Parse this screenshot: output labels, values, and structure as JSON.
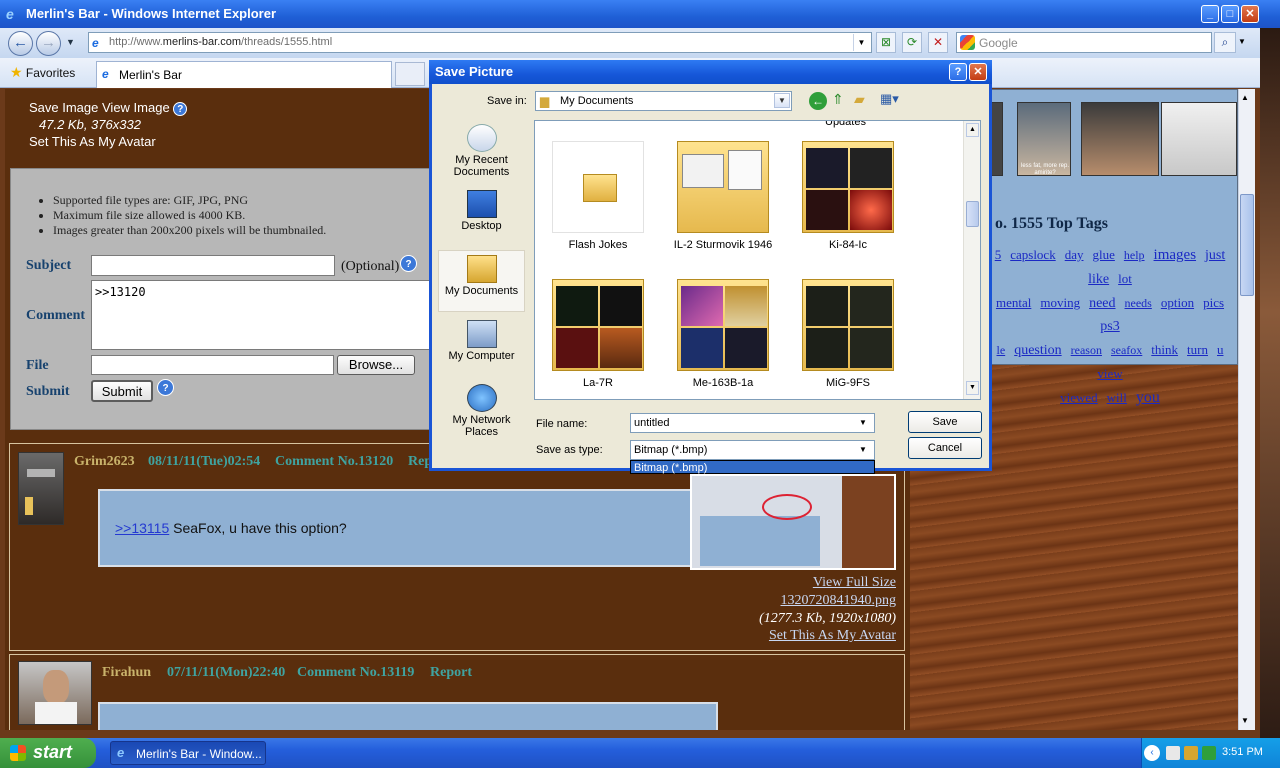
{
  "window": {
    "title": "Merlin's Bar - Windows Internet Explorer",
    "url_prefix": "http://www.",
    "url_domain": "merlins-bar.com",
    "url_path": "/threads/1555.html",
    "search_placeholder": "Google",
    "favorites_label": "Favorites",
    "tab_label": "Merlin's Bar"
  },
  "image_links": {
    "save_image": "Save Image",
    "view_image": "View Image",
    "size_info": "47.2 Kb, 376x332",
    "set_avatar": "Set This As My Avatar"
  },
  "form": {
    "rules": [
      "Supported file types are: GIF, JPG, PNG",
      "Maximum file size allowed is 4000 KB.",
      "Images greater than 200x200 pixels will be thumbnailed."
    ],
    "subject_label": "Subject",
    "optional_label": "(Optional)",
    "comment_label": "Comment",
    "comment_value": ">>13120",
    "file_label": "File",
    "browse_button": "Browse...",
    "submit_label": "Submit",
    "submit_button": "Submit"
  },
  "posts": [
    {
      "poster": "Grim2623",
      "date": "08/11/11(Tue)02:54",
      "comment_no": "Comment No.13120",
      "report": "Report",
      "reply_link": ">>13115",
      "text": " SeaFox, u have this option?",
      "view_full": "View Full Size",
      "filename": "1320720841940.png",
      "fileinfo": "(1277.3 Kb, 1920x1080)",
      "set_avatar": "Set This As My Avatar"
    },
    {
      "poster": "Firahun",
      "date": "07/11/11(Mon)22:40",
      "comment_no": "Comment No.13119",
      "report": "Report"
    }
  ],
  "tags": {
    "title": "o. 1555 Top Tags",
    "words": [
      "5",
      "capslock",
      "day",
      "glue",
      "help",
      "images",
      "just",
      "like",
      "lot",
      "mental",
      "moving",
      "need",
      "needs",
      "option",
      "pics",
      "ps3",
      "le",
      "question",
      "reason",
      "seafox",
      "think",
      "turn",
      "u",
      "view",
      "viewed",
      "will",
      "you"
    ],
    "thumb_caption": "less fat, more rep. amirite?"
  },
  "dialog": {
    "title": "Save Picture",
    "save_in_label": "Save in:",
    "save_in_value": "My Documents",
    "places": [
      "My Recent Documents",
      "Desktop",
      "My Documents",
      "My Computer",
      "My Network Places"
    ],
    "partial_label": "Updates",
    "files": [
      "Flash Jokes",
      "IL-2 Sturmovik 1946",
      "Ki-84-Ic",
      "La-7R",
      "Me-163B-1a",
      "MiG-9FS"
    ],
    "filename_label": "File name:",
    "filename_value": "untitled",
    "savetype_label": "Save as type:",
    "savetype_value": "Bitmap (*.bmp)",
    "dropdown_option": "Bitmap (*.bmp)",
    "save_button": "Save",
    "cancel_button": "Cancel"
  },
  "taskbar": {
    "start": "start",
    "task": "Merlin's Bar - Window...",
    "clock": "3:51 PM"
  }
}
